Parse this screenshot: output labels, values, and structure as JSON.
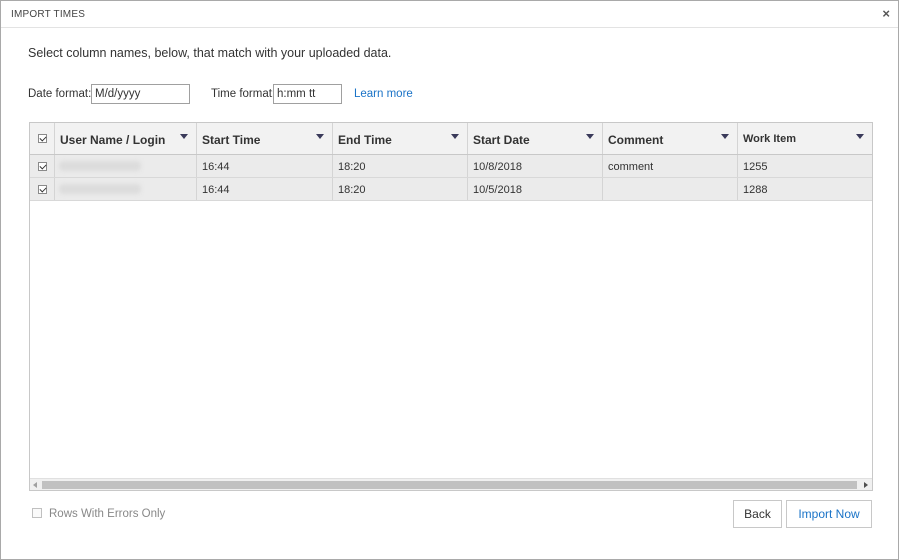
{
  "dialog": {
    "title": "IMPORT TIMES",
    "close_glyph": "×",
    "instruction": "Select column names, below, that match with your uploaded data."
  },
  "formats": {
    "date_label": "Date format:",
    "date_value": "M/d/yyyy",
    "time_label": "Time format:",
    "time_value": "h:mm tt",
    "learn_more": "Learn more"
  },
  "grid": {
    "columns": [
      "User Name / Login",
      "Start Time",
      "End Time",
      "Start Date",
      "Comment",
      "Work Item"
    ],
    "header_all_checked": true,
    "rows": [
      {
        "checked": true,
        "user": "",
        "start_time": "16:44",
        "end_time": "18:20",
        "start_date": "10/8/2018",
        "comment": "comment",
        "work_item": "1255"
      },
      {
        "checked": true,
        "user": "",
        "start_time": "16:44",
        "end_time": "18:20",
        "start_date": "10/5/2018",
        "comment": "",
        "work_item": "1288"
      }
    ]
  },
  "footer": {
    "errors_only_label": "Rows With Errors Only",
    "errors_only_checked": false,
    "back_label": "Back",
    "import_label": "Import Now"
  },
  "colors": {
    "link_accent": "#1a73c7",
    "row_background": "#ebebeb",
    "header_background": "#f2f2f2"
  },
  "icons": {
    "close": "close-icon",
    "column_dropdown": "chevron-down-icon",
    "scroll_left": "arrow-left-icon",
    "scroll_right": "arrow-right-icon"
  }
}
